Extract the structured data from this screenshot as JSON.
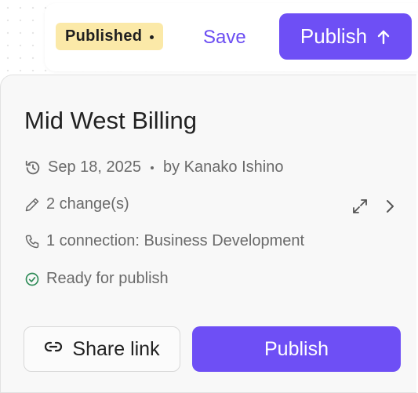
{
  "toolbar": {
    "status": "Published",
    "save_label": "Save",
    "publish_label": "Publish"
  },
  "card": {
    "title": "Mid West Billing",
    "date": "Sep 18, 2025",
    "author": "by Kanako Ishino",
    "changes": "2 change(s)",
    "connection": "1 connection: Business Development",
    "ready": "Ready for publish",
    "share_label": "Share link",
    "publish_label": "Publish"
  },
  "colors": {
    "accent": "#6e4ff5",
    "status_bg": "#fbe9a8",
    "ready_green": "#2e8b57"
  },
  "icons": [
    "arrow-up-icon",
    "history-icon",
    "pencil-icon",
    "expand-icon",
    "chevron-right-icon",
    "phone-icon",
    "check-circle-icon",
    "link-icon"
  ]
}
